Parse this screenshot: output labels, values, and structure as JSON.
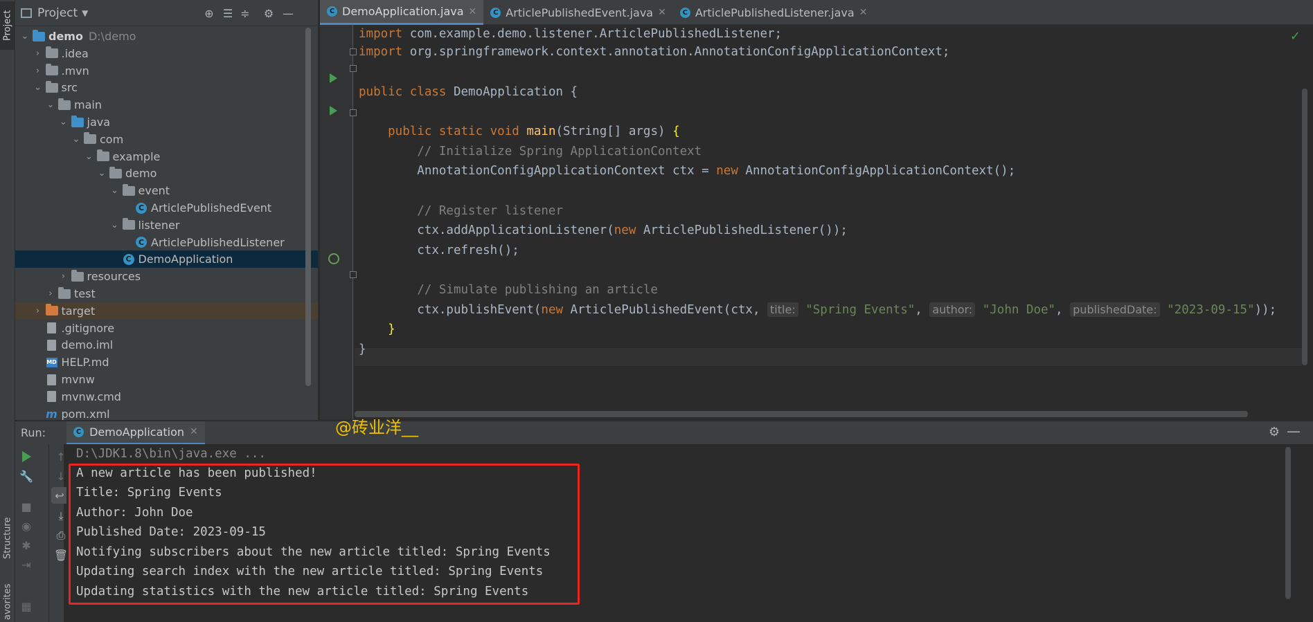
{
  "left_strip": {
    "project_tab": "Project",
    "structure_tab": "Structure",
    "favorites_tab": "avorites"
  },
  "project_panel": {
    "title": "Project",
    "tree": [
      {
        "label": "demo",
        "path": "D:\\demo",
        "type": "folder-blue",
        "indent": 0,
        "arrow": "down"
      },
      {
        "label": ".idea",
        "type": "folder",
        "indent": 1,
        "arrow": "right"
      },
      {
        "label": ".mvn",
        "type": "folder",
        "indent": 1,
        "arrow": "right"
      },
      {
        "label": "src",
        "type": "folder",
        "indent": 1,
        "arrow": "down"
      },
      {
        "label": "main",
        "type": "folder",
        "indent": 2,
        "arrow": "down"
      },
      {
        "label": "java",
        "type": "folder-blue",
        "indent": 3,
        "arrow": "down"
      },
      {
        "label": "com",
        "type": "folder",
        "indent": 4,
        "arrow": "down"
      },
      {
        "label": "example",
        "type": "folder",
        "indent": 5,
        "arrow": "down"
      },
      {
        "label": "demo",
        "type": "folder",
        "indent": 6,
        "arrow": "down"
      },
      {
        "label": "event",
        "type": "folder",
        "indent": 7,
        "arrow": "down"
      },
      {
        "label": "ArticlePublishedEvent",
        "type": "class",
        "indent": 8,
        "arrow": ""
      },
      {
        "label": "listener",
        "type": "folder",
        "indent": 7,
        "arrow": "down"
      },
      {
        "label": "ArticlePublishedListener",
        "type": "class",
        "indent": 8,
        "arrow": ""
      },
      {
        "label": "DemoApplication",
        "type": "class",
        "indent": 7,
        "arrow": "",
        "selected": true
      },
      {
        "label": "resources",
        "type": "folder",
        "indent": 3,
        "arrow": "right"
      },
      {
        "label": "test",
        "type": "folder",
        "indent": 2,
        "arrow": "right"
      },
      {
        "label": "target",
        "type": "folder-orange",
        "indent": 1,
        "arrow": "right",
        "excluded": true
      },
      {
        "label": ".gitignore",
        "type": "file",
        "indent": 1,
        "arrow": ""
      },
      {
        "label": "demo.iml",
        "type": "file",
        "indent": 1,
        "arrow": ""
      },
      {
        "label": "HELP.md",
        "type": "md",
        "indent": 1,
        "arrow": ""
      },
      {
        "label": "mvnw",
        "type": "file",
        "indent": 1,
        "arrow": ""
      },
      {
        "label": "mvnw.cmd",
        "type": "file",
        "indent": 1,
        "arrow": ""
      },
      {
        "label": "pom.xml",
        "type": "maven",
        "indent": 1,
        "arrow": ""
      }
    ]
  },
  "editor": {
    "tabs": [
      {
        "label": "DemoApplication.java",
        "active": true
      },
      {
        "label": "ArticlePublishedEvent.java",
        "active": false
      },
      {
        "label": "ArticlePublishedListener.java",
        "active": false
      }
    ],
    "code": {
      "import1_kw": "import",
      "import1_rest": " com.example.demo.listener.ArticlePublishedListener;",
      "import2_kw": "import",
      "import2_rest": " org.springframework.context.annotation.AnnotationConfigApplicationContext;",
      "class_kw": "public class",
      "class_name": " DemoApplication {",
      "main_kw": "    public static void",
      "main_fn": " main",
      "main_rest": "(String[] args) ",
      "main_brace": "{",
      "comment1": "        // Initialize Spring ApplicationContext",
      "ctx_decl_a": "        AnnotationConfigApplicationContext ctx = ",
      "new_kw": "new",
      "ctx_decl_b": " AnnotationConfigApplicationContext();",
      "comment2": "        // Register listener",
      "listener_a": "        ctx.addApplicationListener(",
      "listener_b": " ArticlePublishedListener());",
      "refresh": "        ctx.refresh();",
      "comment3": "        // Simulate publishing an article",
      "publish_a": "        ctx.publishEvent(",
      "publish_b": " ArticlePublishedEvent(ctx, ",
      "hint_title": "title:",
      "str_title": " \"Spring Events\"",
      "comma1": ", ",
      "hint_author": "author:",
      "str_author": " \"John Doe\"",
      "comma2": ", ",
      "hint_date": "publishedDate:",
      "str_date": " \"2023-09-15\"",
      "publish_end": "));",
      "close_main": "    }",
      "close_class": "}"
    }
  },
  "run_panel": {
    "label": "Run:",
    "tab": "DemoApplication",
    "watermark": "@砖业洋__",
    "console": [
      "D:\\JDK1.8\\bin\\java.exe ...",
      "A new article has been published!",
      "Title: Spring Events",
      "Author: John Doe",
      "Published Date: 2023-09-15",
      "Notifying subscribers about the new article titled: Spring Events",
      "Updating search index with the new article titled: Spring Events",
      "Updating statistics with the new article titled: Spring Events"
    ]
  },
  "colors": {
    "accent": "#4a88c7",
    "run_green": "#499c54",
    "highlight_red": "#e8251e",
    "keyword": "#cc7832",
    "string": "#6a8759"
  }
}
